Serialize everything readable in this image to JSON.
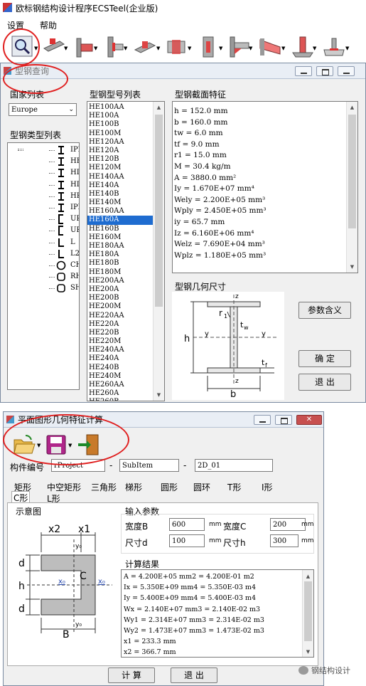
{
  "app": {
    "title": "欧标钢结构设计程序ECSTeel(企业版)"
  },
  "menu": {
    "settings": "设置",
    "help": "帮助"
  },
  "section_window": {
    "title": "型钢查询",
    "country_label": "国家列表",
    "country_value": "Europe",
    "type_list_label": "型钢类型列表",
    "types": [
      "IPE",
      "HE",
      "HD",
      "HL",
      "HP",
      "IPN",
      "UPE",
      "UPN",
      "L",
      "L2",
      "CHS",
      "RHS",
      "SHS"
    ],
    "model_list_label": "型钢型号列表",
    "models": [
      "HE100AA",
      "HE100A",
      "HE100B",
      "HE100M",
      "HE120AA",
      "HE120A",
      "HE120B",
      "HE120M",
      "HE140AA",
      "HE140A",
      "HE140B",
      "HE140M",
      "HE160AA",
      "HE160A",
      "HE160B",
      "HE160M",
      "HE180AA",
      "HE180A",
      "HE180B",
      "HE180M",
      "HE200AA",
      "HE200A",
      "HE200B",
      "HE200M",
      "HE220AA",
      "HE220A",
      "HE220B",
      "HE220M",
      "HE240AA",
      "HE240A",
      "HE240B",
      "HE240M",
      "HE260AA",
      "HE260A",
      "HE260B"
    ],
    "selected_model": "HE160A",
    "props_label": "型钢截面特征",
    "props": [
      "h = 152.0 mm",
      "b = 160.0 mm",
      "tw = 6.0 mm",
      "tf = 9.0 mm",
      "r1 = 15.0 mm",
      "M = 30.4 kg/m",
      "A = 3880.0 mm²",
      "Iy = 1.670E+07 mm⁴",
      "Wely = 2.200E+05 mm³",
      "Wply = 2.450E+05 mm³",
      "iy = 65.7 mm",
      "Iz = 6.160E+06 mm⁴",
      "Welz = 7.690E+04 mm³",
      "Wplz = 1.180E+05 mm³"
    ],
    "geom_label": "型钢几何尺寸",
    "geom_labels": {
      "z": "z",
      "y": "y",
      "h": "h",
      "b": "b",
      "r": "r",
      "r_sub": "1",
      "tw": "t",
      "tw_sub": "w",
      "tf": "t",
      "tf_sub": "f"
    },
    "meaning_button": "参数含义",
    "ok_button": "确  定",
    "exit_button": "退  出"
  },
  "plane_window": {
    "title": "平面图形几何特征计算",
    "component_label": "构件编号",
    "project": "rProject",
    "subitem": "SubItem",
    "item": "2D_01",
    "dash": "-",
    "tabs": [
      "矩形",
      "中空矩形",
      "三角形",
      "梯形",
      "圆形",
      "圆环",
      "T形",
      "I形"
    ],
    "tabs_row2": [
      "C形",
      "L形"
    ],
    "diagram_label": "示意图",
    "diagram_labels": {
      "x2": "x2",
      "x1": "x1",
      "y0": "y₀",
      "y0b": "y₀",
      "x0": "x₀",
      "x0b": "x₀",
      "C": "C",
      "d1": "d",
      "h": "h",
      "d2": "d",
      "B": "B"
    },
    "input_label": "输入参数",
    "inputs": [
      {
        "label": "宽度B",
        "value": "600",
        "unit": "mm"
      },
      {
        "label": "宽度C",
        "value": "200",
        "unit": "mm"
      },
      {
        "label": "尺寸d",
        "value": "100",
        "unit": "mm"
      },
      {
        "label": "尺寸h",
        "value": "300",
        "unit": "mm"
      }
    ],
    "result_label": "计算结果",
    "results": [
      "A = 4.200E+05 mm2 = 4.200E-01 m2",
      "Ix = 5.350E+09 mm4 = 5.350E-03 m4",
      "Iy = 5.400E+09 mm4 = 5.400E-03 m4",
      "Wx = 2.140E+07 mm3 = 2.140E-02 m3",
      "Wy1 = 2.314E+07 mm3 = 2.314E-02 m3",
      "Wy2 = 1.473E+07 mm3 = 1.473E-02 m3",
      "x1 = 233.3 mm",
      "x2 = 366.7 mm"
    ],
    "calc_button": "计  算",
    "exit_button": "退  出"
  },
  "watermark": "钢结构设计",
  "colors": {
    "accent_red": "#e01f1f",
    "selection": "#1e6cd0",
    "titlebar": "#e9eef5"
  }
}
